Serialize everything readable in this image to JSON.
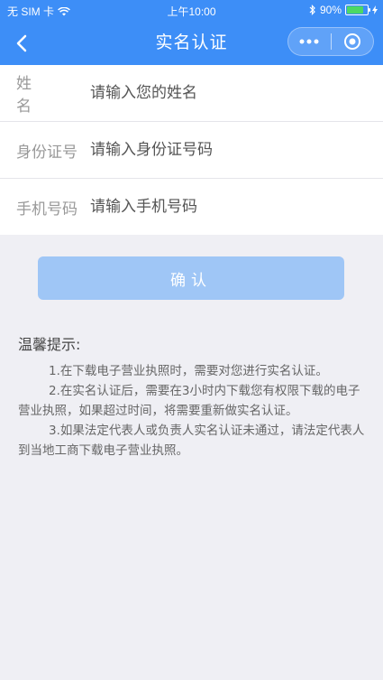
{
  "status_bar": {
    "carrier": "无 SIM 卡",
    "time": "上午10:00",
    "battery": "90%",
    "battery_level": 0.9
  },
  "nav": {
    "title": "实名认证"
  },
  "form": {
    "fields": [
      {
        "label": "姓名",
        "placeholder": "请输入您的姓名"
      },
      {
        "label": "身份证号",
        "placeholder": "请输入身份证号码"
      },
      {
        "label": "手机号码",
        "placeholder": "请输入手机号码"
      }
    ]
  },
  "confirm_button": "确认",
  "tips": {
    "title": "温馨提示:",
    "items": [
      "1.在下载电子营业执照时，需要对您进行实名认证。",
      "2.在实名认证后，需要在3小时内下载您有权限下载的电子营业执照，如果超过时间，将需要重新做实名认证。",
      "3.如果法定代表人或负责人实名认证未通过，请法定代表人到当地工商下载电子营业执照。"
    ]
  },
  "colors": {
    "primary": "#3d8ef7",
    "button_disabled": "#9fc6f6",
    "background": "#efeff4"
  }
}
